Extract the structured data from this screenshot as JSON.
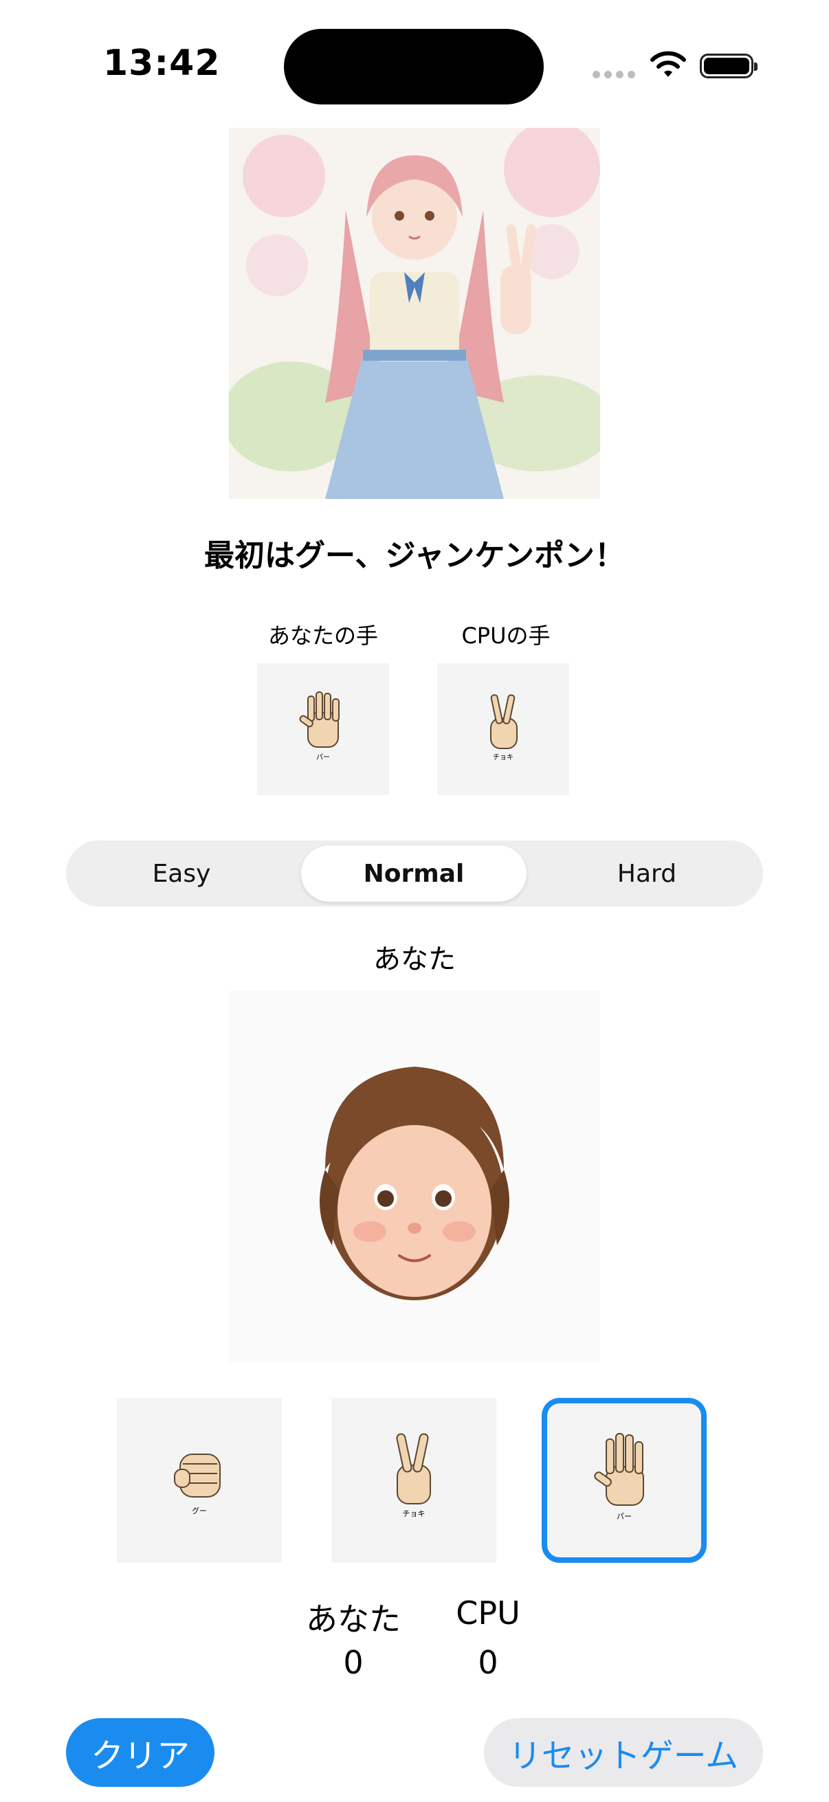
{
  "status": {
    "time": "13:42"
  },
  "header": {
    "title": "最初はグー、ジャンケンポン！"
  },
  "hands": {
    "you_label": "あなたの手",
    "cpu_label": "CPUの手",
    "you_hand": {
      "icon": "paper-hand-icon",
      "caption": "パー"
    },
    "cpu_hand": {
      "icon": "scissors-hand-icon",
      "caption": "チョキ"
    }
  },
  "difficulty": {
    "options": [
      "Easy",
      "Normal",
      "Hard"
    ],
    "selected": "Normal"
  },
  "player": {
    "label": "あなた"
  },
  "choices": [
    {
      "icon": "rock-hand-icon",
      "caption": "グー",
      "selected": false
    },
    {
      "icon": "scissors-hand-icon",
      "caption": "チョキ",
      "selected": false
    },
    {
      "icon": "paper-hand-icon",
      "caption": "パー",
      "selected": true
    }
  ],
  "score": {
    "you_label": "あなた",
    "you_value": "0",
    "cpu_label": "CPU",
    "cpu_value": "0"
  },
  "buttons": {
    "clear": "クリア",
    "reset": "リセットゲーム"
  },
  "colors": {
    "accent": "#1a8cf0"
  }
}
